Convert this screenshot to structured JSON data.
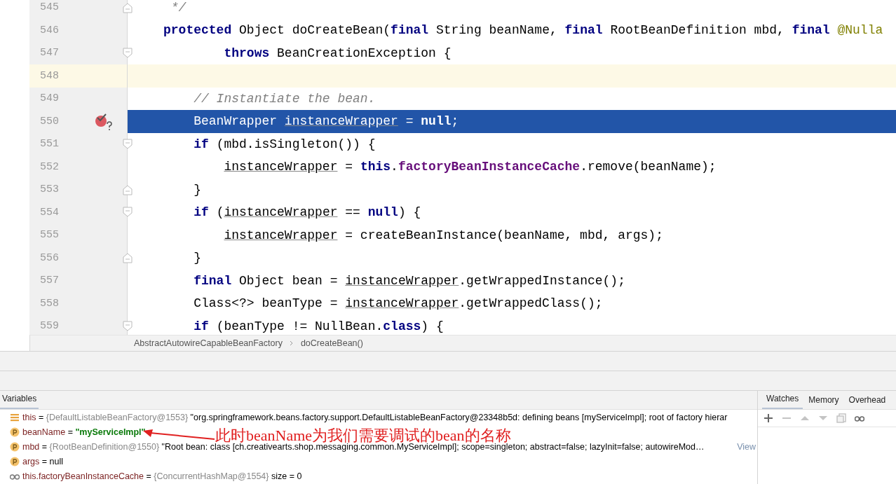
{
  "editor": {
    "lines": [
      {
        "number": "545",
        "kind": "foldend",
        "current": false,
        "caret": false,
        "breakpoint": false,
        "tokens": [
          {
            "kind": "comment",
            "text": " */"
          }
        ]
      },
      {
        "number": "546",
        "kind": "plain",
        "current": false,
        "caret": false,
        "breakpoint": false,
        "tokens": [
          {
            "kind": "kw",
            "text": "protected"
          },
          {
            "kind": "plain",
            "text": " Object doCreateBean("
          },
          {
            "kind": "kw",
            "text": "final"
          },
          {
            "kind": "plain",
            "text": " String beanName, "
          },
          {
            "kind": "kw",
            "text": "final"
          },
          {
            "kind": "plain",
            "text": " RootBeanDefinition mbd, "
          },
          {
            "kind": "kw",
            "text": "final"
          },
          {
            "kind": "annotation",
            "text": " @Nulla"
          }
        ]
      },
      {
        "number": "547",
        "kind": "foldstart",
        "current": false,
        "caret": false,
        "breakpoint": false,
        "tokens": [
          {
            "kind": "kw",
            "text": "        throws"
          },
          {
            "kind": "plain",
            "text": " BeanCreationException {"
          }
        ]
      },
      {
        "number": "548",
        "kind": "plain",
        "current": false,
        "caret": true,
        "breakpoint": false
      },
      {
        "number": "549",
        "kind": "plain",
        "current": false,
        "caret": false,
        "breakpoint": false,
        "tokens": [
          {
            "kind": "comment",
            "text": "    // Instantiate the bean."
          }
        ]
      },
      {
        "number": "550",
        "kind": "plain",
        "current": true,
        "caret": false,
        "breakpoint": true,
        "tokens": [
          {
            "kind": "plain",
            "text": "    BeanWrapper "
          },
          {
            "kind": "var",
            "text": "instanceWrapper"
          },
          {
            "kind": "plain",
            "text": " = "
          },
          {
            "kind": "kw",
            "text": "null"
          },
          {
            "kind": "plain",
            "text": ";"
          }
        ]
      },
      {
        "number": "551",
        "kind": "foldstart",
        "current": false,
        "caret": false,
        "breakpoint": false,
        "tokens": [
          {
            "kind": "kw",
            "text": "    if"
          },
          {
            "kind": "plain",
            "text": " (mbd.isSingleton()) {"
          }
        ]
      },
      {
        "number": "552",
        "kind": "plain",
        "current": false,
        "caret": false,
        "breakpoint": false,
        "tokens": [
          {
            "kind": "var",
            "text": "        instanceWrapper"
          },
          {
            "kind": "plain",
            "text": " = "
          },
          {
            "kind": "kw",
            "text": "this"
          },
          {
            "kind": "plain",
            "text": "."
          },
          {
            "kind": "field",
            "text": "factoryBeanInstanceCache"
          },
          {
            "kind": "plain",
            "text": ".remove(beanName);"
          }
        ]
      },
      {
        "number": "553",
        "kind": "foldend",
        "current": false,
        "caret": false,
        "breakpoint": false,
        "tokens": [
          {
            "kind": "plain",
            "text": "    }"
          }
        ]
      },
      {
        "number": "554",
        "kind": "foldstart",
        "current": false,
        "caret": false,
        "breakpoint": false,
        "tokens": [
          {
            "kind": "kw",
            "text": "    if"
          },
          {
            "kind": "plain",
            "text": " ("
          },
          {
            "kind": "var",
            "text": "instanceWrapper"
          },
          {
            "kind": "plain",
            "text": " == "
          },
          {
            "kind": "kw",
            "text": "null"
          },
          {
            "kind": "plain",
            "text": ") {"
          }
        ]
      },
      {
        "number": "555",
        "kind": "plain",
        "current": false,
        "caret": false,
        "breakpoint": false,
        "tokens": [
          {
            "kind": "var",
            "text": "        instanceWrapper"
          },
          {
            "kind": "plain",
            "text": " = createBeanInstance(beanName, mbd, args);"
          }
        ]
      },
      {
        "number": "556",
        "kind": "foldend",
        "current": false,
        "caret": false,
        "breakpoint": false,
        "tokens": [
          {
            "kind": "plain",
            "text": "    }"
          }
        ]
      },
      {
        "number": "557",
        "kind": "plain",
        "current": false,
        "caret": false,
        "breakpoint": false,
        "tokens": [
          {
            "kind": "kw",
            "text": "    final"
          },
          {
            "kind": "plain",
            "text": " Object bean = "
          },
          {
            "kind": "var",
            "text": "instanceWrapper"
          },
          {
            "kind": "plain",
            "text": ".getWrappedInstance();"
          }
        ]
      },
      {
        "number": "558",
        "kind": "plain",
        "current": false,
        "caret": false,
        "breakpoint": false,
        "tokens": [
          {
            "kind": "plain",
            "text": "    Class<?> beanType = "
          },
          {
            "kind": "var",
            "text": "instanceWrapper"
          },
          {
            "kind": "plain",
            "text": ".getWrappedClass();"
          }
        ]
      },
      {
        "number": "559",
        "kind": "foldstart",
        "current": false,
        "caret": false,
        "breakpoint": false,
        "tokens": [
          {
            "kind": "kw",
            "text": "    if"
          },
          {
            "kind": "plain",
            "text": " (beanType != NullBean."
          },
          {
            "kind": "kw",
            "text": "class"
          },
          {
            "kind": "plain",
            "text": ") {"
          }
        ]
      }
    ]
  },
  "breadcrumbs": [
    "AbstractAutowireCapableBeanFactory",
    "doCreateBean()"
  ],
  "variables": {
    "title": "Variables",
    "rows": [
      {
        "kind": "object",
        "name": "this",
        "assign": "=",
        "type": "{DefaultListableBeanFactory@1553}",
        "value": "\"org.springframework.beans.factory.support.DefaultListableBeanFactory@23348b5d: defining beans [myServiceImpl]; root of factory hierar",
        "is_string": false
      },
      {
        "kind": "param",
        "name": "beanName",
        "assign": "=",
        "value": "\"myServiceImpl\"",
        "is_string": true
      },
      {
        "kind": "param",
        "name": "mbd",
        "assign": "=",
        "type": "{RootBeanDefinition@1550}",
        "value": "\"Root bean: class [ch.creativearts.shop.messaging.common.MyServiceImpl]; scope=singleton; abstract=false; lazyInit=false; autowireMod…",
        "is_string": false,
        "link": "View"
      },
      {
        "kind": "param",
        "name": "args",
        "assign": "=",
        "value": "null",
        "is_string": false
      },
      {
        "kind": "watch",
        "name": "this.factoryBeanInstanceCache",
        "assign": "=",
        "type": "{ConcurrentHashMap@1554}",
        "value": "size = 0",
        "is_string": false
      }
    ]
  },
  "side_panel": {
    "tabs": [
      {
        "label": "Watches",
        "selected": true
      },
      {
        "label": "Memory",
        "selected": false
      },
      {
        "label": "Overhead",
        "selected": false
      }
    ],
    "toolbar": [
      {
        "kind": "add",
        "disabled": false
      },
      {
        "kind": "remove",
        "disabled": true
      },
      {
        "kind": "up",
        "disabled": true
      },
      {
        "kind": "down",
        "disabled": true
      },
      {
        "kind": "copy",
        "disabled": true
      },
      {
        "kind": "glasses",
        "disabled": false
      }
    ]
  },
  "annotation": {
    "text": "此时beanName为我们需要调试的bean的名称"
  }
}
